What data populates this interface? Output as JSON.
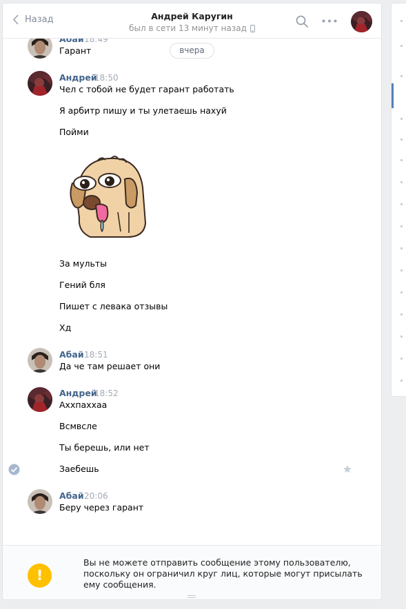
{
  "header": {
    "back_label": "Назад",
    "contact_name": "Андрей Каругин",
    "status": "был в сети 13 минут назад"
  },
  "date_divider": "вчера",
  "messages": {
    "g1": {
      "author": "Абай",
      "time": "18:49",
      "lines": [
        "Гарант"
      ]
    },
    "g2": {
      "author": "Андрей",
      "time": "18:50",
      "lines": [
        "Чел с тобой не будет гарант работать",
        "Я арбитр пишу и ты улетаешь нахуй",
        "Пойми",
        "За мульты",
        "Гений бля",
        "Пишет с левака отзывы",
        "Хд"
      ]
    },
    "g3": {
      "author": "Абай",
      "time": "18:51",
      "lines": [
        "Да че там решает они"
      ]
    },
    "g4": {
      "author": "Андрей",
      "time": "18:52",
      "lines": [
        "Аххпаххаа",
        "Всмвсле",
        "Ты берешь, или нет",
        "Заебешь"
      ]
    },
    "g5": {
      "author": "Абай",
      "time": "20:06",
      "lines": [
        "Беру через гарант"
      ]
    }
  },
  "notice": {
    "lines": [
      "Вы не можете отправить сообщение этому пользователю,",
      "поскольку он ограничил круг лиц, которые могут присылать",
      "ему сообщения."
    ]
  },
  "icons": {
    "warning": "!",
    "sticker": "dog-sticker",
    "read": "check-icon",
    "favorite": "star-icon"
  },
  "colors": {
    "author": "#42648b",
    "accent": "#5181b8",
    "warning": "#ffc000",
    "muted": "#939393"
  }
}
